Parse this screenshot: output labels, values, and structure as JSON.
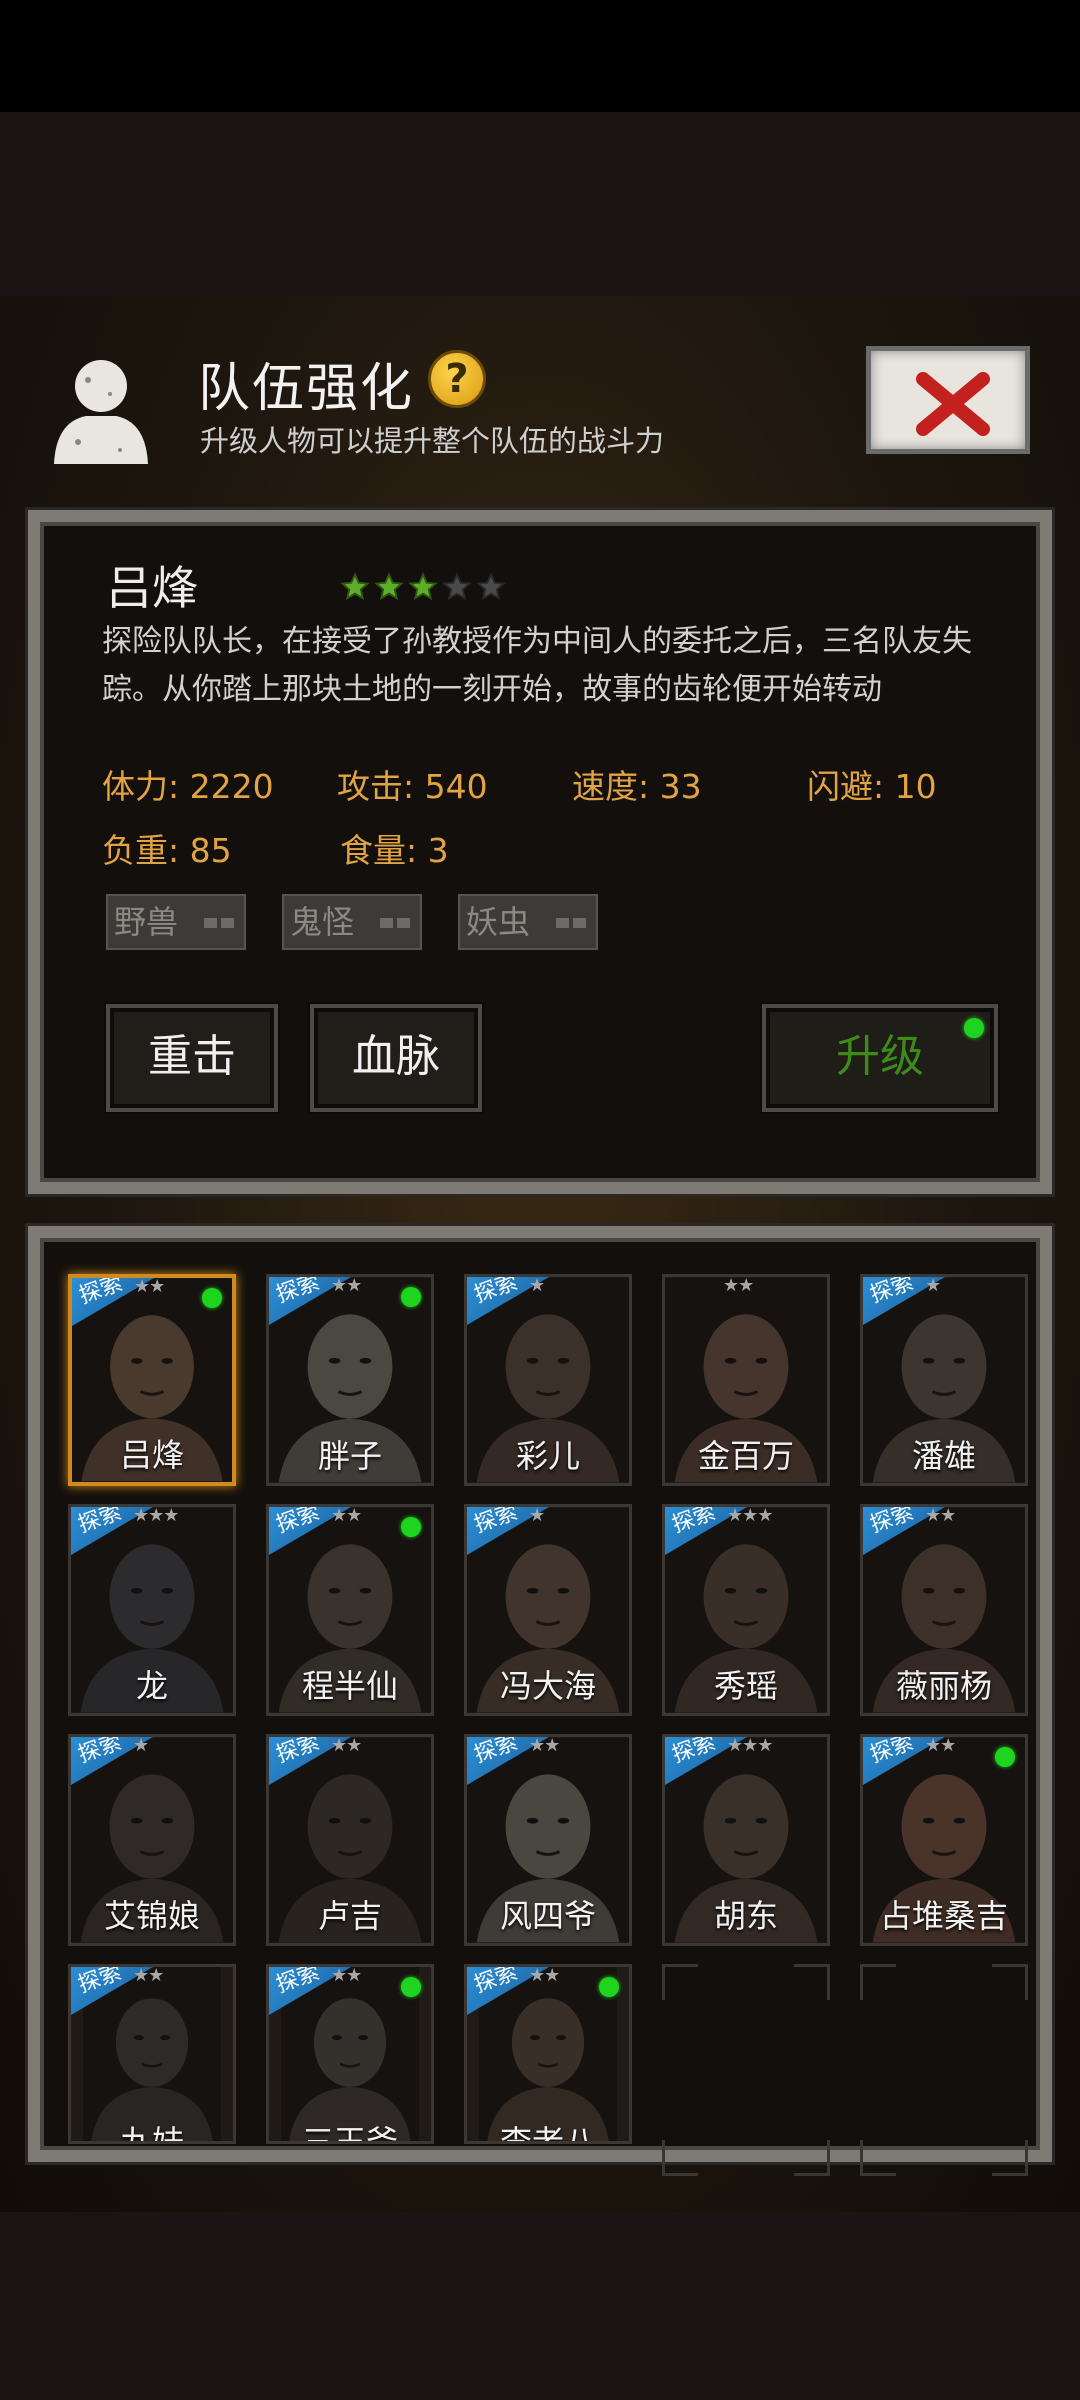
{
  "header": {
    "title": "队伍强化",
    "subtitle": "升级人物可以提升整个队伍的战斗力",
    "help_glyph": "?"
  },
  "selected": {
    "name": "吕烽",
    "star_level": 3,
    "star_max": 5,
    "description": "探险队队长，在接受了孙教授作为中间人的委托之后，三名队友失踪。从你踏上那块土地的一刻开始，故事的齿轮便开始转动",
    "stats": [
      {
        "label": "体力: 2220"
      },
      {
        "label": "攻击: 540"
      },
      {
        "label": "速度: 33"
      },
      {
        "label": "闪避: 10"
      },
      {
        "label": "负重: 85"
      },
      {
        "label": "食量: 3"
      }
    ],
    "tags": [
      "野兽",
      "鬼怪",
      "妖虫"
    ]
  },
  "buttons": {
    "heavy_strike": "重击",
    "bloodline": "血脉",
    "upgrade": "升级"
  },
  "roster": [
    {
      "name": "吕烽",
      "stars": "★★",
      "badge": "探索",
      "dot": true,
      "selected": true,
      "tone": "#4a3a2e"
    },
    {
      "name": "胖子",
      "stars": "★★",
      "badge": "探索",
      "dot": true,
      "tone": "#4b4741"
    },
    {
      "name": "彩儿",
      "stars": "★",
      "badge": "探索",
      "dot": false,
      "tone": "#3c302a"
    },
    {
      "name": "金百万",
      "stars": "★★",
      "badge": "",
      "dot": false,
      "tone": "#45352c"
    },
    {
      "name": "潘雄",
      "stars": "★",
      "badge": "探索",
      "dot": false,
      "tone": "#3d3630"
    },
    {
      "name": "龙",
      "stars": "★★★",
      "badge": "探索",
      "dot": false,
      "tone": "#2c2c2e"
    },
    {
      "name": "程半仙",
      "stars": "★★",
      "badge": "探索",
      "dot": true,
      "tone": "#3a332d"
    },
    {
      "name": "冯大海",
      "stars": "★",
      "badge": "探索",
      "dot": false,
      "tone": "#40342c"
    },
    {
      "name": "秀瑶",
      "stars": "★★★",
      "badge": "探索",
      "dot": false,
      "tone": "#3a2e28"
    },
    {
      "name": "薇丽杨",
      "stars": "★★",
      "badge": "探索",
      "dot": false,
      "tone": "#3c3029"
    },
    {
      "name": "艾锦娘",
      "stars": "★",
      "badge": "探索",
      "dot": false,
      "tone": "#2f2a27"
    },
    {
      "name": "卢吉",
      "stars": "★★",
      "badge": "探索",
      "dot": false,
      "tone": "#2e2824"
    },
    {
      "name": "风四爷",
      "stars": "★★",
      "badge": "探索",
      "dot": false,
      "tone": "#4a4640"
    },
    {
      "name": "胡东",
      "stars": "★★★",
      "badge": "探索",
      "dot": false,
      "tone": "#3a302a"
    },
    {
      "name": "占堆桑吉",
      "stars": "★★",
      "badge": "探索",
      "dot": true,
      "tone": "#4a342a"
    },
    {
      "name": "九妹",
      "stars": "★★",
      "badge": "探索",
      "dot": false,
      "tone": "#2e2a28"
    },
    {
      "name": "三王爷",
      "stars": "★★",
      "badge": "探索",
      "dot": true,
      "tone": "#34302c"
    },
    {
      "name": "李老八",
      "stars": "★★",
      "badge": "探索",
      "dot": true,
      "tone": "#3a2f28"
    },
    {
      "name": "",
      "empty": true
    },
    {
      "name": "",
      "empty": true
    }
  ],
  "colors": {
    "stat": "#e2a342",
    "upgrade_text": "#3e8a1b",
    "star_on": "#5fae2a",
    "star_off": "#4a4a4a",
    "dot": "#1ed41e",
    "badge": "#2c8fd6",
    "selected_border": "#d08a1e"
  }
}
